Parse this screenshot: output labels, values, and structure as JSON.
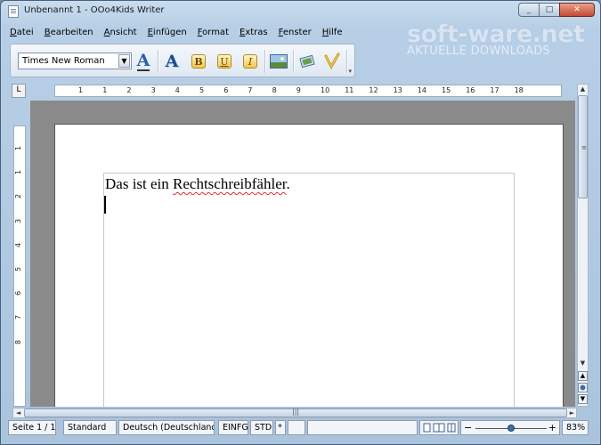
{
  "window": {
    "title": "Unbenannt 1 - OOo4Kids Writer",
    "minimize_glyph": "_",
    "maximize_glyph": "□",
    "close_glyph": "✕"
  },
  "menubar": {
    "items": [
      {
        "ul": "D",
        "rest": "atei"
      },
      {
        "ul": "B",
        "rest": "earbeiten"
      },
      {
        "ul": "A",
        "rest": "nsicht"
      },
      {
        "ul": "E",
        "rest": "infügen"
      },
      {
        "ul": "F",
        "rest": "ormat"
      },
      {
        "ul": "E",
        "rest": "xtras"
      },
      {
        "ul": "F",
        "rest": "enster"
      },
      {
        "ul": "H",
        "rest": "ilfe"
      }
    ]
  },
  "toolbar": {
    "font_name": "Times New Roman",
    "dropdown_glyph": "▼",
    "bold_label": "B",
    "underline_label": "U",
    "italic_label": "I",
    "big_a_label": "A",
    "overflow_glyph": "▾"
  },
  "watermark": {
    "main": "soft-ware.net",
    "sub": "AKTUELLE DOWNLOADS"
  },
  "ruler": {
    "corner_glyph": "L",
    "h_numbers": [
      "1",
      "1",
      "2",
      "3",
      "4",
      "5",
      "6",
      "7",
      "8",
      "9",
      "10",
      "11",
      "12",
      "13",
      "14",
      "15",
      "16",
      "17",
      "18"
    ],
    "v_numbers": [
      "1",
      "1",
      "2",
      "3",
      "4",
      "5",
      "6",
      "7",
      "8"
    ]
  },
  "document": {
    "text_before": "Das ist ein ",
    "misspelled": "Rechtschreibfähler",
    "text_after": "."
  },
  "statusbar": {
    "page": "Seite 1 / 1",
    "style": "Standard",
    "language": "Deutsch (Deutschland)",
    "insert_mode": "EINFG",
    "selection_mode": "STD",
    "modified": "*",
    "zoom": "83%",
    "zoom_minus": "−",
    "zoom_plus": "+",
    "zoom_level": 0.5
  },
  "scrollbars": {
    "up": "▲",
    "down": "▼",
    "left": "◄",
    "right": "►",
    "grip_v": "≡",
    "grip_h": "|||"
  }
}
